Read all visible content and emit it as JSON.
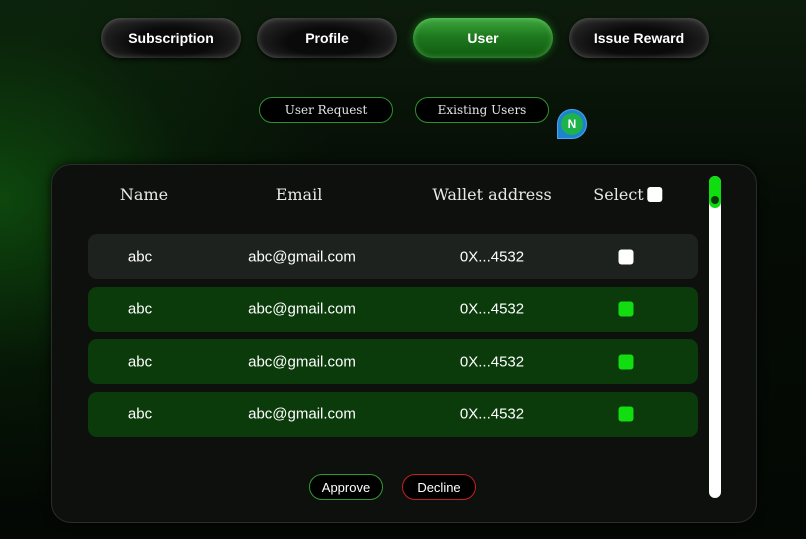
{
  "top_tabs": [
    {
      "label": "Subscription",
      "active": false
    },
    {
      "label": "Profile",
      "active": false
    },
    {
      "label": "User",
      "active": true
    },
    {
      "label": "Issue Reward",
      "active": false
    }
  ],
  "sub_tabs": [
    {
      "label": "User Request"
    },
    {
      "label": "Existing Users"
    }
  ],
  "avatar": {
    "initial": "N",
    "color": "#1db34a"
  },
  "table": {
    "headers": {
      "name": "Name",
      "email": "Email",
      "wallet": "Wallet address",
      "select": "Select"
    },
    "rows": [
      {
        "name": "abc",
        "email": "abc@gmail.com",
        "wallet": "0X...4532",
        "selected": false
      },
      {
        "name": "abc",
        "email": "abc@gmail.com",
        "wallet": "0X...4532",
        "selected": true
      },
      {
        "name": "abc",
        "email": "abc@gmail.com",
        "wallet": "0X...4532",
        "selected": true
      },
      {
        "name": "abc",
        "email": "abc@gmail.com",
        "wallet": "0X...4532",
        "selected": true
      }
    ]
  },
  "actions": {
    "approve_label": "Approve",
    "decline_label": "Decline"
  },
  "colors": {
    "accent_green": "#11dd11",
    "selected_row": "#0b3b0b",
    "decline_red": "#c42020"
  }
}
